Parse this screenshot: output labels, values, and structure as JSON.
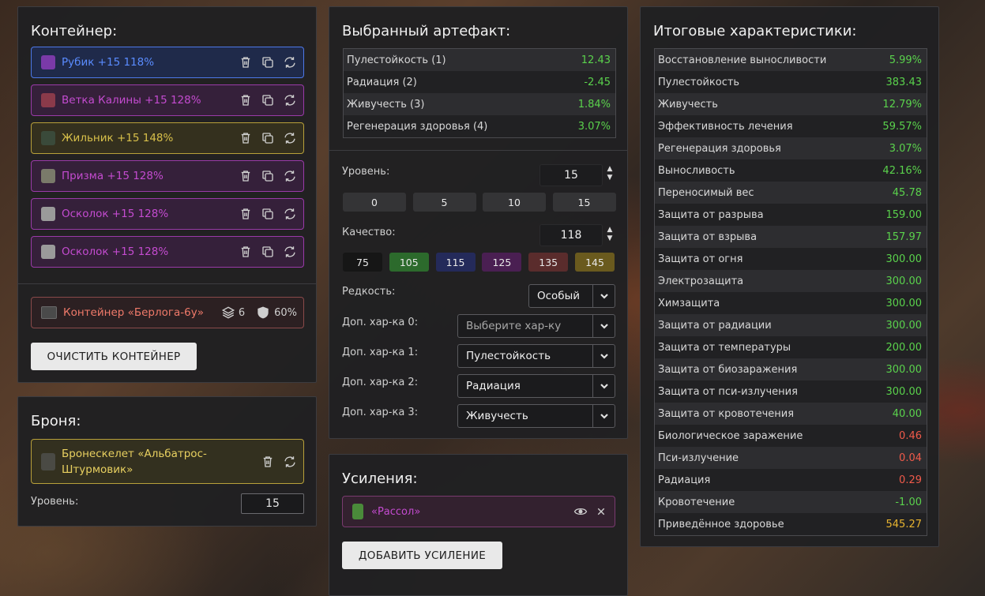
{
  "container_panel": {
    "title": "Контейнер:",
    "items": [
      {
        "name": "Рубик +15 118%",
        "color": "#5a8cff",
        "bg": "#1f2a4a",
        "border": "#4d78e8",
        "thumb": "#7a3aa8"
      },
      {
        "name": "Ветка Калины +15 128%",
        "color": "#c44bd0",
        "bg": "#35203a",
        "border": "#9a3aa8",
        "thumb": "#8a3a4a"
      },
      {
        "name": "Жильник +15 148%",
        "color": "#d8c04a",
        "bg": "#34301e",
        "border": "#b8a03a",
        "thumb": "#3a4a3a"
      },
      {
        "name": "Призма +15 128%",
        "color": "#c44bd0",
        "bg": "#35203a",
        "border": "#9a3aa8",
        "thumb": "#7a7a6a"
      },
      {
        "name": "Осколок +15 128%",
        "color": "#c44bd0",
        "bg": "#35203a",
        "border": "#9a3aa8",
        "thumb": "#9a9a9a"
      },
      {
        "name": "Осколок +15 128%",
        "color": "#c44bd0",
        "bg": "#35203a",
        "border": "#9a3aa8",
        "thumb": "#9a9a9a"
      }
    ],
    "container_box": {
      "name": "Контейнер «Берлога-6у»",
      "slots": "6",
      "protection": "60%"
    },
    "clear_button": "ОЧИСТИТЬ КОНТЕЙНЕР"
  },
  "armor_panel": {
    "title": "Броня:",
    "armor_name_line1": "Бронескелет «Альбатрос-",
    "armor_name_line2": "Штурмовик»",
    "level_label": "Уровень:",
    "level_value": "15"
  },
  "artifact_panel": {
    "title": "Выбранный артефакт:",
    "stats": [
      {
        "label": "Пулестойкость (1)",
        "value": "12.43",
        "kind": "pos"
      },
      {
        "label": "Радиация (2)",
        "value": "-2.45",
        "kind": "pos"
      },
      {
        "label": "Живучесть (3)",
        "value": "1.84%",
        "kind": "pos"
      },
      {
        "label": "Регенерация здоровья (4)",
        "value": "3.07%",
        "kind": "pos"
      }
    ],
    "level_label": "Уровень:",
    "level_value": "15",
    "level_presets": [
      "0",
      "5",
      "10",
      "15"
    ],
    "quality_label": "Качество:",
    "quality_value": "118",
    "quality_presets": [
      {
        "label": "75",
        "bg": "#161616"
      },
      {
        "label": "105",
        "bg": "#2c6a2c"
      },
      {
        "label": "115",
        "bg": "#242a5a"
      },
      {
        "label": "125",
        "bg": "#4a1f52"
      },
      {
        "label": "135",
        "bg": "#5a2c2c"
      },
      {
        "label": "145",
        "bg": "#6a5a1e"
      }
    ],
    "rarity_label": "Редкость:",
    "rarity_value": "Особый",
    "extra": [
      {
        "label": "Доп. хар-ка 0:",
        "value": "Выберите хар-ку",
        "placeholder": true
      },
      {
        "label": "Доп. хар-ка 1:",
        "value": "Пулестойкость",
        "placeholder": false
      },
      {
        "label": "Доп. хар-ка 2:",
        "value": "Радиация",
        "placeholder": false
      },
      {
        "label": "Доп. хар-ка 3:",
        "value": "Живучесть",
        "placeholder": false
      }
    ]
  },
  "boost_panel": {
    "title": "Усиления:",
    "item": "«Рассол»",
    "add_button": "ДОБАВИТЬ УСИЛЕНИЕ"
  },
  "totals_panel": {
    "title": "Итоговые характеристики:",
    "stats": [
      {
        "label": "Восстановление выносливости",
        "value": "5.99%",
        "kind": "pos"
      },
      {
        "label": "Пулестойкость",
        "value": "383.43",
        "kind": "pos"
      },
      {
        "label": "Живучесть",
        "value": "12.79%",
        "kind": "pos"
      },
      {
        "label": "Эффективность лечения",
        "value": "59.57%",
        "kind": "pos"
      },
      {
        "label": "Регенерация здоровья",
        "value": "3.07%",
        "kind": "pos"
      },
      {
        "label": "Выносливость",
        "value": "42.16%",
        "kind": "pos"
      },
      {
        "label": "Переносимый вес",
        "value": "45.78",
        "kind": "pos"
      },
      {
        "label": "Защита от разрыва",
        "value": "159.00",
        "kind": "pos"
      },
      {
        "label": "Защита от взрыва",
        "value": "157.97",
        "kind": "pos"
      },
      {
        "label": "Защита от огня",
        "value": "300.00",
        "kind": "pos"
      },
      {
        "label": "Электрозащита",
        "value": "300.00",
        "kind": "pos"
      },
      {
        "label": "Химзащита",
        "value": "300.00",
        "kind": "pos"
      },
      {
        "label": "Защита от радиации",
        "value": "300.00",
        "kind": "pos"
      },
      {
        "label": "Защита от температуры",
        "value": "200.00",
        "kind": "pos"
      },
      {
        "label": "Защита от биозаражения",
        "value": "300.00",
        "kind": "pos"
      },
      {
        "label": "Защита от пси-излучения",
        "value": "300.00",
        "kind": "pos"
      },
      {
        "label": "Защита от кровотечения",
        "value": "40.00",
        "kind": "pos"
      },
      {
        "label": "Биологическое заражение",
        "value": "0.46",
        "kind": "neg"
      },
      {
        "label": "Пси-излучение",
        "value": "0.04",
        "kind": "neg"
      },
      {
        "label": "Радиация",
        "value": "0.29",
        "kind": "neg"
      },
      {
        "label": "Кровотечение",
        "value": "-1.00",
        "kind": "pos"
      },
      {
        "label": "Приведённое здоровье",
        "value": "545.27",
        "kind": "gold"
      }
    ]
  },
  "icons": {
    "item_actions": [
      "trash-icon",
      "copy-icon",
      "swap-icon"
    ],
    "container_slots": "layers-icon",
    "container_protection": "shield-icon",
    "boost_view": "eye-icon",
    "boost_remove": "close-icon"
  }
}
